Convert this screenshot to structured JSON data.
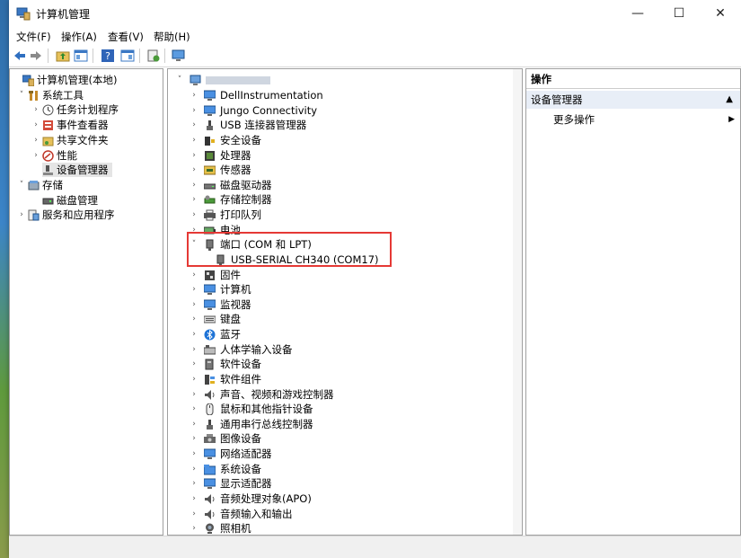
{
  "window": {
    "title": "计算机管理",
    "controls": [
      "—",
      "☐",
      "✕"
    ]
  },
  "menu": [
    "文件(F)",
    "操作(A)",
    "查看(V)",
    "帮助(H)"
  ],
  "left_tree": [
    {
      "label": "计算机管理(本地)",
      "level": 0,
      "arrow": "",
      "icon": "computer-mgmt-icon"
    },
    {
      "label": "系统工具",
      "level": 1,
      "arrow": "˅",
      "icon": "tools-icon"
    },
    {
      "label": "任务计划程序",
      "level": 2,
      "arrow": "›",
      "icon": "clock-icon"
    },
    {
      "label": "事件查看器",
      "level": 2,
      "arrow": "›",
      "icon": "event-viewer-icon"
    },
    {
      "label": "共享文件夹",
      "level": 2,
      "arrow": "›",
      "icon": "shared-folder-icon"
    },
    {
      "label": "性能",
      "level": 2,
      "arrow": "›",
      "icon": "performance-icon"
    },
    {
      "label": "设备管理器",
      "level": 2,
      "arrow": "",
      "icon": "device-manager-icon",
      "selected": true
    },
    {
      "label": "存储",
      "level": 1,
      "arrow": "˅",
      "icon": "storage-icon"
    },
    {
      "label": "磁盘管理",
      "level": 2,
      "arrow": "",
      "icon": "disk-mgmt-icon"
    },
    {
      "label": "服务和应用程序",
      "level": 1,
      "arrow": "›",
      "icon": "services-icon"
    }
  ],
  "device_tree": [
    {
      "label": "DellInstrumentation",
      "icon": "monitor-icon"
    },
    {
      "label": "Jungo Connectivity",
      "icon": "monitor-icon"
    },
    {
      "label": "USB 连接器管理器",
      "icon": "usb-icon"
    },
    {
      "label": "安全设备",
      "icon": "security-icon"
    },
    {
      "label": "处理器",
      "icon": "cpu-icon"
    },
    {
      "label": "传感器",
      "icon": "sensor-icon"
    },
    {
      "label": "磁盘驱动器",
      "icon": "disk-icon"
    },
    {
      "label": "存储控制器",
      "icon": "storage-controller-icon"
    },
    {
      "label": "打印队列",
      "icon": "printer-icon"
    },
    {
      "label": "电池",
      "icon": "battery-icon"
    },
    {
      "label": "端口 (COM 和 LPT)",
      "icon": "port-icon",
      "expanded": true
    },
    {
      "label": "USB-SERIAL CH340 (COM17)",
      "icon": "port-icon",
      "child": true
    },
    {
      "label": "固件",
      "icon": "firmware-icon"
    },
    {
      "label": "计算机",
      "icon": "monitor-icon"
    },
    {
      "label": "监视器",
      "icon": "monitor-icon"
    },
    {
      "label": "键盘",
      "icon": "keyboard-icon"
    },
    {
      "label": "蓝牙",
      "icon": "bluetooth-icon"
    },
    {
      "label": "人体学输入设备",
      "icon": "hid-icon"
    },
    {
      "label": "软件设备",
      "icon": "software-device-icon"
    },
    {
      "label": "软件组件",
      "icon": "software-component-icon"
    },
    {
      "label": "声音、视频和游戏控制器",
      "icon": "speaker-icon"
    },
    {
      "label": "鼠标和其他指针设备",
      "icon": "mouse-icon"
    },
    {
      "label": "通用串行总线控制器",
      "icon": "usb-icon"
    },
    {
      "label": "图像设备",
      "icon": "camera-icon"
    },
    {
      "label": "网络适配器",
      "icon": "monitor-icon"
    },
    {
      "label": "系统设备",
      "icon": "folder-icon"
    },
    {
      "label": "显示适配器",
      "icon": "monitor-icon"
    },
    {
      "label": "音频处理对象(APO)",
      "icon": "speaker-icon"
    },
    {
      "label": "音频输入和输出",
      "icon": "speaker-icon"
    },
    {
      "label": "照相机",
      "icon": "webcam-icon"
    }
  ],
  "actions": {
    "header": "操作",
    "section": "设备管理器",
    "section_arrow": "▲",
    "item": "更多操作",
    "item_arrow": "▶"
  }
}
